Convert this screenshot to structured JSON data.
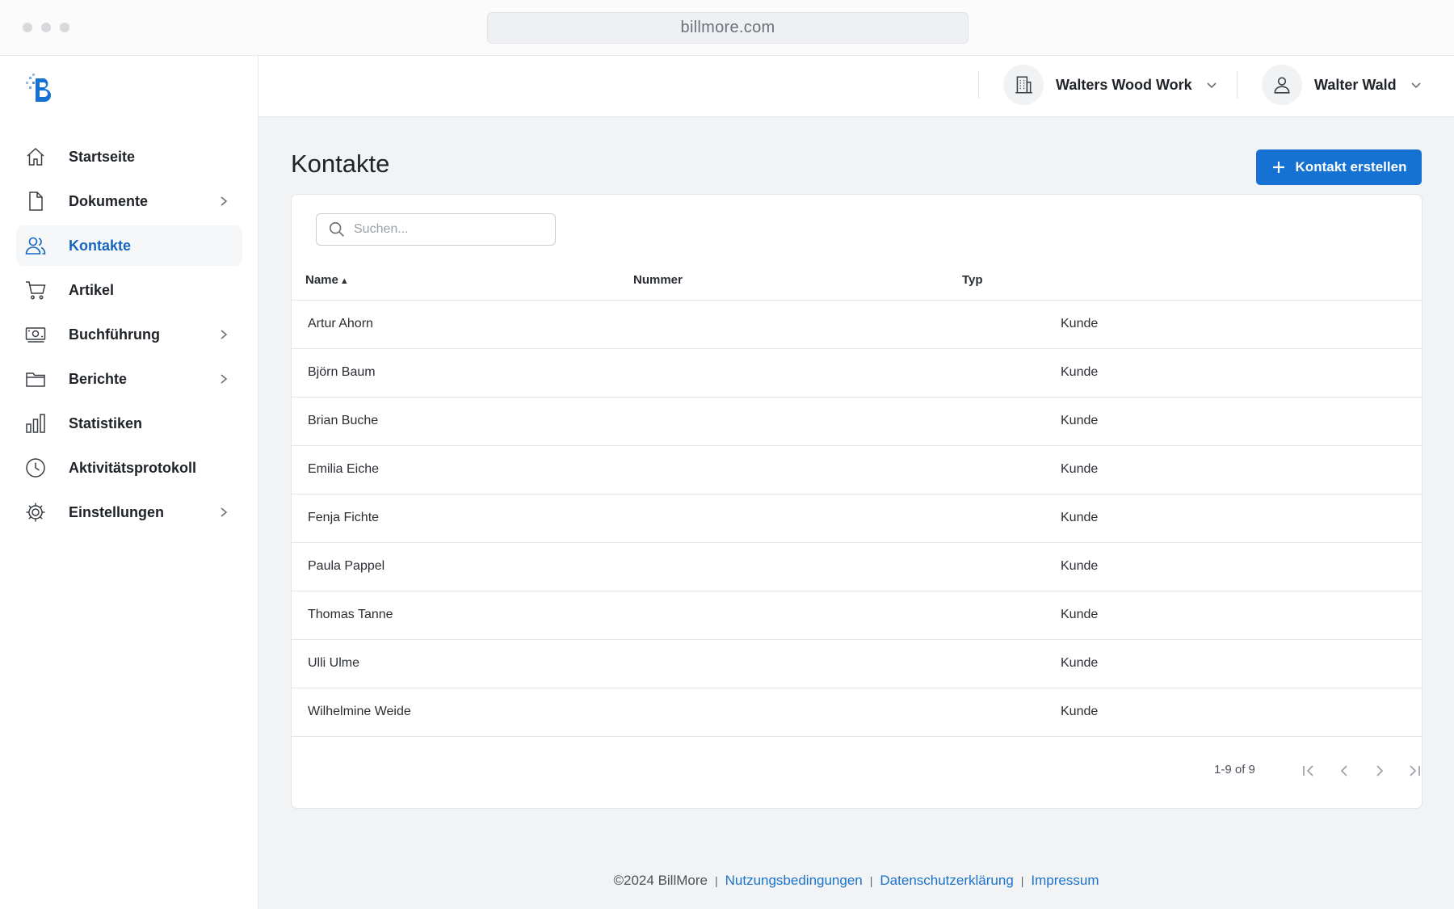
{
  "browser": {
    "url": "billmore.com"
  },
  "sidebar": {
    "items": [
      {
        "label": "Startseite",
        "icon": "home-icon",
        "active": false,
        "has_submenu": false
      },
      {
        "label": "Dokumente",
        "icon": "document-icon",
        "active": false,
        "has_submenu": true
      },
      {
        "label": "Kontakte",
        "icon": "users-icon",
        "active": true,
        "has_submenu": false
      },
      {
        "label": "Artikel",
        "icon": "cart-icon",
        "active": false,
        "has_submenu": false
      },
      {
        "label": "Buchführung",
        "icon": "money-icon",
        "active": false,
        "has_submenu": true
      },
      {
        "label": "Berichte",
        "icon": "folder-icon",
        "active": false,
        "has_submenu": true
      },
      {
        "label": "Statistiken",
        "icon": "bar-chart-icon",
        "active": false,
        "has_submenu": false
      },
      {
        "label": "Aktivitätsprotokoll",
        "icon": "clock-icon",
        "active": false,
        "has_submenu": false
      },
      {
        "label": "Einstellungen",
        "icon": "gear-icon",
        "active": false,
        "has_submenu": true
      }
    ]
  },
  "header": {
    "company": "Walters Wood Work",
    "user": "Walter Wald"
  },
  "main": {
    "title": "Kontakte",
    "create_button": "Kontakt erstellen",
    "search_placeholder": "Suchen...",
    "columns": [
      "Name",
      "Nummer",
      "Typ"
    ],
    "sort": {
      "column": "Name",
      "direction": "▲"
    },
    "rows": [
      {
        "name": "Artur Ahorn",
        "number": "",
        "type": "Kunde"
      },
      {
        "name": "Björn Baum",
        "number": "",
        "type": "Kunde"
      },
      {
        "name": "Brian Buche",
        "number": "",
        "type": "Kunde"
      },
      {
        "name": "Emilia Eiche",
        "number": "",
        "type": "Kunde"
      },
      {
        "name": "Fenja Fichte",
        "number": "",
        "type": "Kunde"
      },
      {
        "name": "Paula Pappel",
        "number": "",
        "type": "Kunde"
      },
      {
        "name": "Thomas Tanne",
        "number": "",
        "type": "Kunde"
      },
      {
        "name": "Ulli Ulme",
        "number": "",
        "type": "Kunde"
      },
      {
        "name": "Wilhelmine Weide",
        "number": "",
        "type": "Kunde"
      }
    ],
    "pagination": "1-9 of 9"
  },
  "footer": {
    "copyright": "©2024 BillMore",
    "separator": "|",
    "links": [
      "Nutzungsbedingungen",
      "Datenschutzerklärung",
      "Impressum"
    ]
  },
  "colors": {
    "accent": "#1572d3",
    "active_nav": "#1565c0",
    "link": "#1a73c9"
  }
}
